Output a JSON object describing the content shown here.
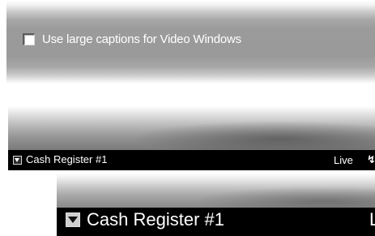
{
  "settings": {
    "large_captions_checkbox": {
      "label": "Use large captions for Video Windows",
      "checked": false
    }
  },
  "video_windows": {
    "small_caption": {
      "title": "Cash Register #1",
      "status": "Live",
      "status_icon": "lightning-bolt-icon"
    },
    "large_caption": {
      "title": "Cash Register #1",
      "status": "L"
    }
  },
  "colors": {
    "caption_bar": "#000000",
    "caption_text": "#ffffff",
    "panel": "#9a9a9a"
  }
}
